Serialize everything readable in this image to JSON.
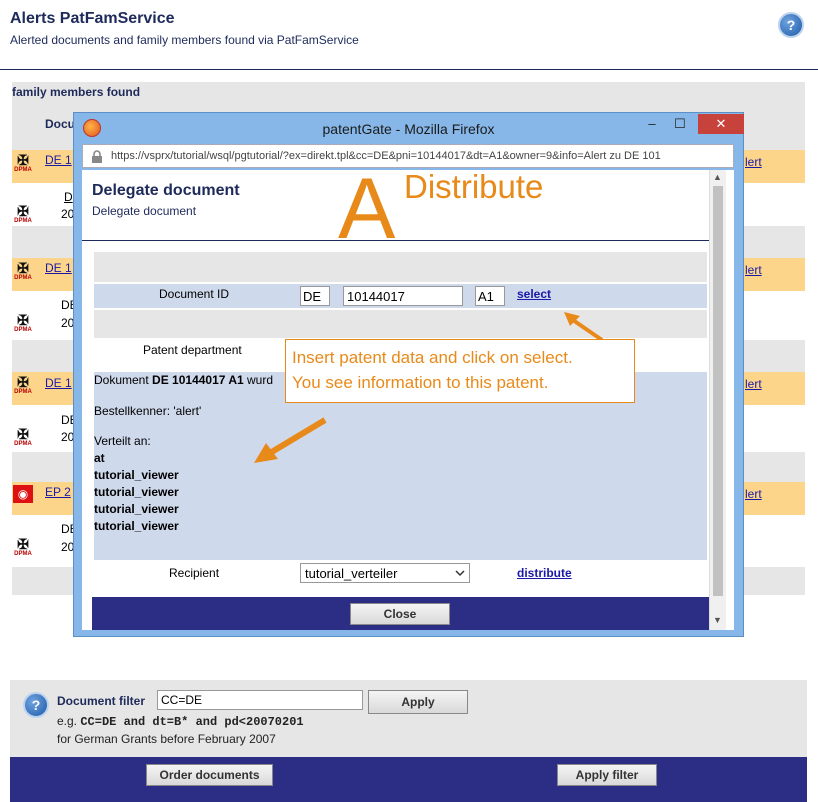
{
  "header": {
    "title": "Alerts PatFamService",
    "subtitle": "Alerted documents and family members found via PatFamService",
    "help_glyph": "?"
  },
  "family_section": {
    "heading": "family members found",
    "column_header": "Docu",
    "rows": [
      {
        "doc_link": "DE 1",
        "line1": "D",
        "line2": "20",
        "right_link": "lert",
        "icon": "dpma-eagle-icon"
      },
      {
        "doc_link": "DE 1",
        "line1": "DE",
        "line2": "20",
        "right_link": "lert",
        "icon": "dpma-eagle-icon"
      },
      {
        "doc_link": "DE 1",
        "line1": "DE",
        "line2": "20",
        "right_link": "lert",
        "icon": "dpma-eagle-icon"
      },
      {
        "doc_link": "EP 2",
        "line1": "DE",
        "line2": "20",
        "right_link": "lert",
        "icon": "epo-logo-icon"
      }
    ],
    "dpma_label": "DPMA"
  },
  "popup": {
    "window_title": "patentGate - Mozilla Firefox",
    "url": "https://vsprx/tutorial/wsql/pgtutorial/?ex=direkt.tpl&cc=DE&pni=10144017&dt=A1&owner=9&info=Alert zu DE 101",
    "minimize_glyph": "–",
    "maximize_glyph": "☐",
    "close_glyph": "✕",
    "heading": "Delegate document",
    "subheading": "Delegate document",
    "form": {
      "document_id_label": "Document ID",
      "cc_value": "DE",
      "number_value": "10144017",
      "kind_value": "A1",
      "select_link": "select",
      "patent_department_label": "Patent department",
      "info_prefix": "Dokument",
      "info_doc": "DE 10144017 A1",
      "info_suffix": "wurd",
      "order_code_line": "Bestellkenner: 'alert'",
      "distributed_label": "Verteilt an:",
      "recipients": [
        "at",
        "tutorial_viewer",
        "tutorial_viewer",
        "tutorial_viewer",
        "tutorial_viewer"
      ],
      "recipient_label": "Recipient",
      "recipient_selected": "tutorial_verteiler",
      "distribute_link": "distribute",
      "close_button": "Close"
    }
  },
  "annotations": {
    "big_letter": "A",
    "distribute_word": "Distribute",
    "instruction_line1": "Insert patent data and click on select.",
    "instruction_line2": "You see information to this patent.",
    "color": "#e88a1a"
  },
  "filter": {
    "label": "Document filter",
    "value": "CC=DE",
    "apply_button": "Apply",
    "example_prefix": "e.g.",
    "example_code": "CC=DE and dt=B* and pd<20070201",
    "hint": "for German Grants before February 2007"
  },
  "bottom_bar": {
    "order_button": "Order documents",
    "apply_filter_button": "Apply filter"
  }
}
